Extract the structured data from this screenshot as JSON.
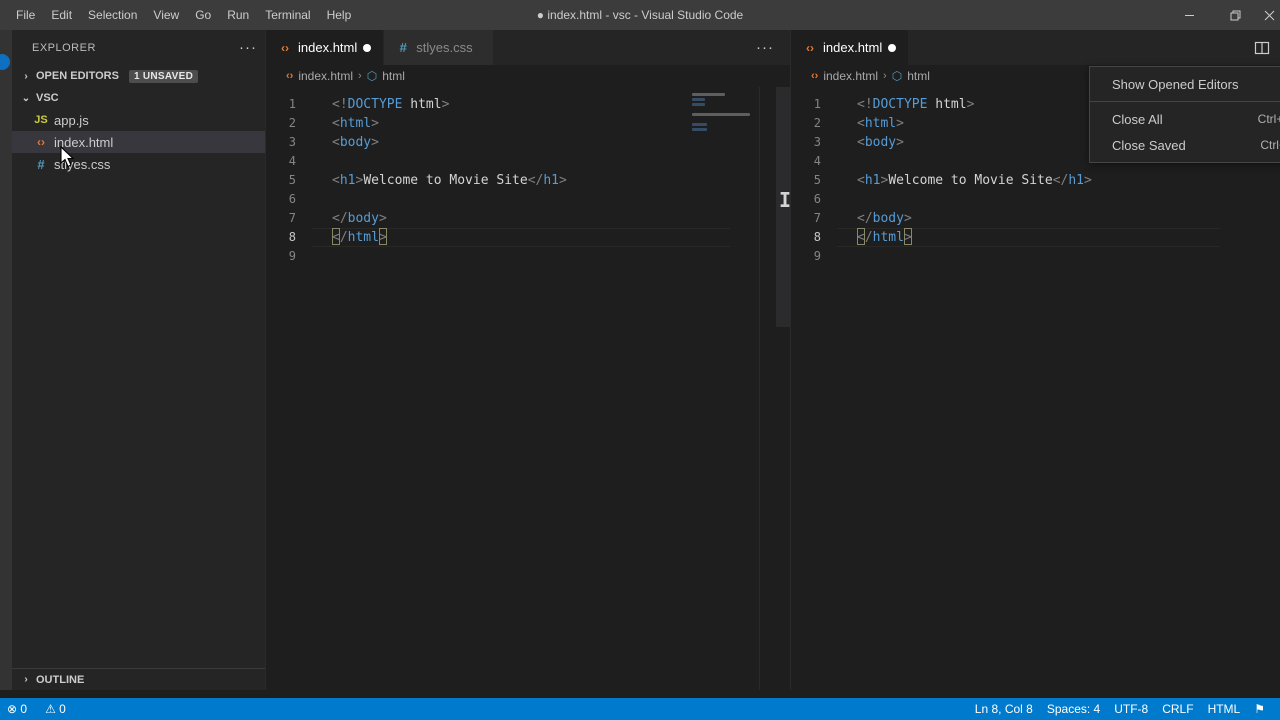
{
  "window": {
    "title": "● index.html - vsc - Visual Studio Code",
    "minimize_label": "—",
    "restore_label": "❐",
    "close_label": "✕"
  },
  "menubar": {
    "items": [
      {
        "label": "File"
      },
      {
        "label": "Edit"
      },
      {
        "label": "Selection"
      },
      {
        "label": "View"
      },
      {
        "label": "Go"
      },
      {
        "label": "Run"
      },
      {
        "label": "Terminal"
      },
      {
        "label": "Help"
      }
    ]
  },
  "sidebar": {
    "title": "EXPLORER",
    "more_label": "···",
    "open_editors": {
      "label": "OPEN EDITORS",
      "twisty": "›",
      "badge": "1 UNSAVED"
    },
    "folder": {
      "label": "VSC",
      "twisty": "⌄"
    },
    "files": [
      {
        "name": "app.js",
        "icon": "JS",
        "icon_kind": "js",
        "selected": false
      },
      {
        "name": "index.html",
        "icon": "‹›",
        "icon_kind": "html",
        "selected": true
      },
      {
        "name": "stlyes.css",
        "icon": "#",
        "icon_kind": "css",
        "selected": false
      }
    ],
    "outline": {
      "label": "OUTLINE",
      "twisty": "›"
    }
  },
  "editor_left": {
    "tabs": [
      {
        "label": "index.html",
        "icon": "‹›",
        "icon_kind": "html",
        "active": true,
        "dirty": true
      },
      {
        "label": "stlyes.css",
        "icon": "#",
        "icon_kind": "css",
        "active": false,
        "dirty": false
      }
    ],
    "tabs_more_label": "···",
    "breadcrumbs": {
      "file": "index.html",
      "separator": "›",
      "symbol": "html",
      "file_icon": "‹›",
      "symbol_icon": "⬡"
    }
  },
  "editor_right": {
    "tabs": [
      {
        "label": "index.html",
        "icon": "‹›",
        "icon_kind": "html",
        "active": true,
        "dirty": true
      }
    ],
    "split_icon_name": "split-editor-icon",
    "breadcrumbs": {
      "file": "index.html",
      "separator": "›",
      "symbol": "html",
      "file_icon": "‹›",
      "symbol_icon": "⬡"
    }
  },
  "code": {
    "language": "HTML",
    "active_line": 8,
    "lines": [
      {
        "num": "1",
        "tokens": [
          {
            "t": "<!",
            "c": "punct"
          },
          {
            "t": "DOCTYPE",
            "c": "doctype"
          },
          {
            "t": " ",
            "c": "text"
          },
          {
            "t": "html",
            "c": "text"
          },
          {
            "t": ">",
            "c": "punct"
          }
        ]
      },
      {
        "num": "2",
        "tokens": [
          {
            "t": "<",
            "c": "punct"
          },
          {
            "t": "html",
            "c": "tag"
          },
          {
            "t": ">",
            "c": "punct"
          }
        ]
      },
      {
        "num": "3",
        "tokens": [
          {
            "t": "<",
            "c": "punct"
          },
          {
            "t": "body",
            "c": "tag"
          },
          {
            "t": ">",
            "c": "punct"
          }
        ]
      },
      {
        "num": "4",
        "tokens": []
      },
      {
        "num": "5",
        "tokens": [
          {
            "t": "<",
            "c": "punct"
          },
          {
            "t": "h1",
            "c": "tag"
          },
          {
            "t": ">",
            "c": "punct"
          },
          {
            "t": "Welcome to Movie Site",
            "c": "text"
          },
          {
            "t": "</",
            "c": "punct"
          },
          {
            "t": "h1",
            "c": "tag"
          },
          {
            "t": ">",
            "c": "punct"
          }
        ]
      },
      {
        "num": "6",
        "tokens": []
      },
      {
        "num": "7",
        "tokens": [
          {
            "t": "</",
            "c": "punct"
          },
          {
            "t": "body",
            "c": "tag"
          },
          {
            "t": ">",
            "c": "punct"
          }
        ]
      },
      {
        "num": "8",
        "tokens": [
          {
            "t": "</",
            "c": "punct"
          },
          {
            "t": "html",
            "c": "tag"
          },
          {
            "t": ">",
            "c": "punct"
          }
        ]
      },
      {
        "num": "9",
        "tokens": []
      }
    ]
  },
  "context_menu": {
    "items": [
      {
        "label": "Show Opened Editors",
        "shortcut": "",
        "separator_after": true
      },
      {
        "label": "Close All",
        "shortcut": "Ctrl+K W",
        "separator_after": false
      },
      {
        "label": "Close Saved",
        "shortcut": "Ctrl+K U",
        "separator_after": false
      }
    ]
  },
  "statusbar": {
    "left": [
      {
        "label": "⊗ 0",
        "name": "errors-count"
      },
      {
        "label": "⚠ 0",
        "name": "warnings-count"
      }
    ],
    "right": [
      {
        "label": "Ln 8, Col 8",
        "name": "cursor-position"
      },
      {
        "label": "Spaces: 4",
        "name": "indentation"
      },
      {
        "label": "UTF-8",
        "name": "encoding"
      },
      {
        "label": "CRLF",
        "name": "eol"
      },
      {
        "label": "HTML",
        "name": "language-mode"
      },
      {
        "label": "⚑",
        "name": "feedback-icon"
      }
    ]
  },
  "colors": {
    "accent": "#007acc",
    "editor_bg": "#1e1e1e",
    "sidebar_bg": "#252526",
    "titlebar_bg": "#3c3c3c",
    "tag": "#569cd6",
    "text": "#d4d4d4",
    "html_icon": "#e37933",
    "css_icon": "#519aba",
    "js_icon": "#cbcb41"
  }
}
